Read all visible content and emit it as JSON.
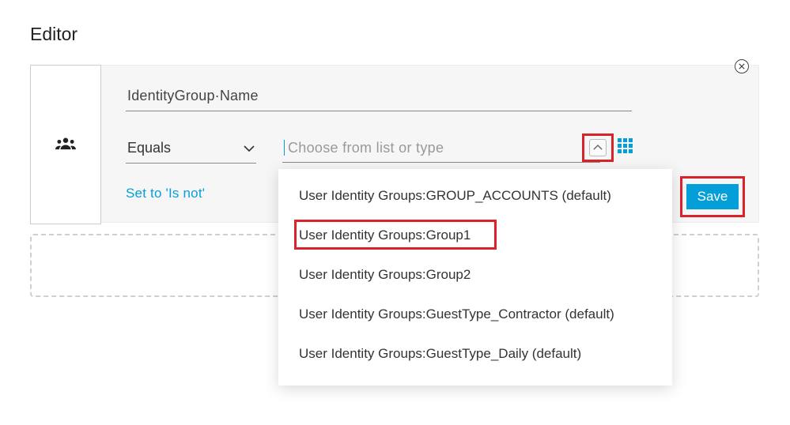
{
  "page": {
    "title": "Editor"
  },
  "panel": {
    "attribute": "IdentityGroup·Name",
    "operator": "Equals",
    "value_placeholder": "Choose from list or type",
    "isnot_label": "Set to 'Is not'",
    "save_label": "Save"
  },
  "dropdown": {
    "items": [
      {
        "label": "User Identity Groups:GROUP_ACCOUNTS (default)"
      },
      {
        "label": "User Identity Groups:Group1"
      },
      {
        "label": "User Identity Groups:Group2"
      },
      {
        "label": "User Identity Groups:GuestType_Contractor (default)"
      },
      {
        "label": "User Identity Groups:GuestType_Daily (default)"
      }
    ]
  },
  "highlights": {
    "chevron_up": true,
    "save_button": true,
    "group1_item": true
  },
  "colors": {
    "accent": "#049fd9",
    "highlight": "#d8232a"
  }
}
